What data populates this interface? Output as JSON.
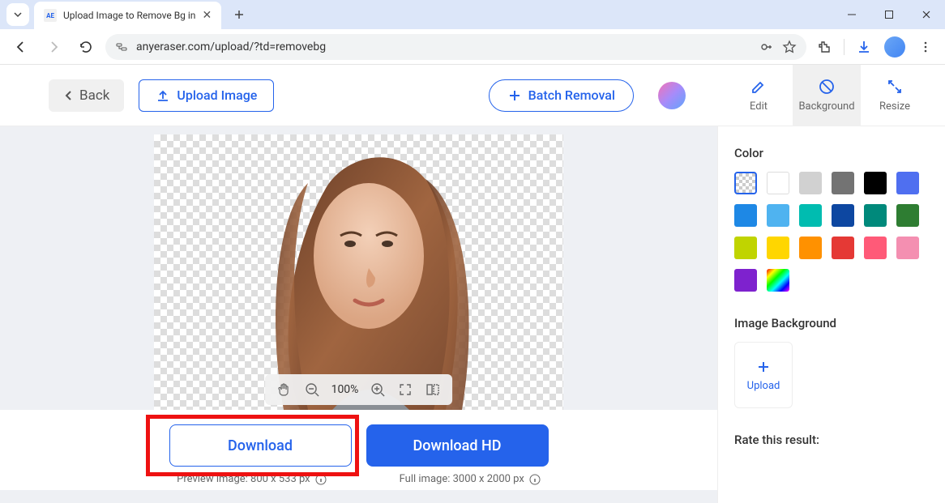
{
  "browser": {
    "tab_title": "Upload Image to Remove Bg in",
    "favicon": "AE",
    "url": "anyeraser.com/upload/?td=removebg"
  },
  "header": {
    "back": "Back",
    "upload": "Upload Image",
    "batch": "Batch Removal",
    "tabs": {
      "edit": "Edit",
      "background": "Background",
      "resize": "Resize"
    }
  },
  "canvas": {
    "zoom": "100%"
  },
  "download": {
    "normal": "Download",
    "hd": "Download HD",
    "preview": "Preview image: 800 x 533 px",
    "full": "Full image: 3000 x 2000 px"
  },
  "side": {
    "color": "Color",
    "image_bg": "Image Background",
    "upload": "Upload",
    "rate": "Rate this result:",
    "colors": [
      "transparent",
      "#ffffff",
      "#d1d1d1",
      "#737373",
      "#000000",
      "#4f6ff0",
      "#1e88e5",
      "#4fb3f0",
      "#00bcb0",
      "#0d47a1",
      "#00897b",
      "#2e7d32",
      "#c0d400",
      "#ffd600",
      "#ff9100",
      "#e53935",
      "#ff5a78",
      "#f48fb1",
      "#7e22ce",
      "rainbow"
    ]
  }
}
